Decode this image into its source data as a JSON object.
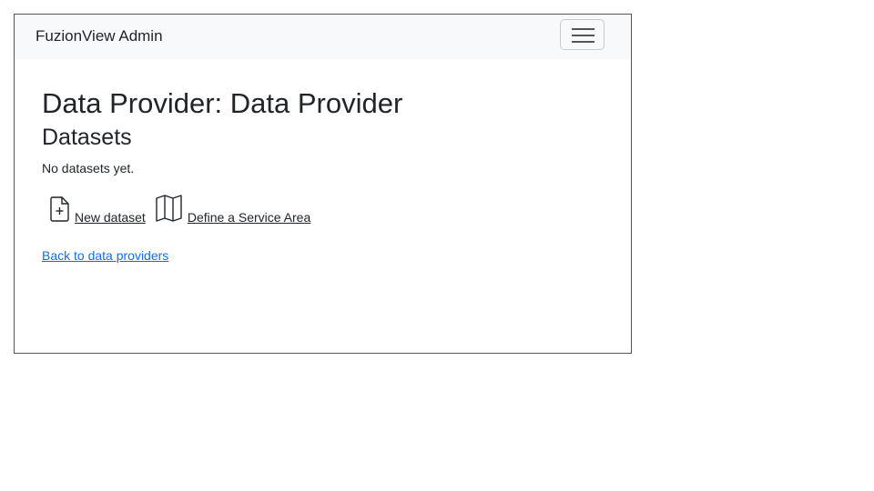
{
  "navbar": {
    "brand": "FuzionView Admin",
    "toggler_icon": "hamburger-menu-icon"
  },
  "main": {
    "title": "Data Provider: Data Provider",
    "section_heading": "Datasets",
    "empty_message": "No datasets yet.",
    "actions": [
      {
        "icon": "file-plus-icon",
        "label": "New dataset"
      },
      {
        "icon": "map-icon",
        "label": "Define a Service Area"
      }
    ],
    "back_link": "Back to data providers"
  },
  "colors": {
    "navbar_bg": "#f8f9fa",
    "text": "#212529",
    "link": "#0d6efd"
  }
}
